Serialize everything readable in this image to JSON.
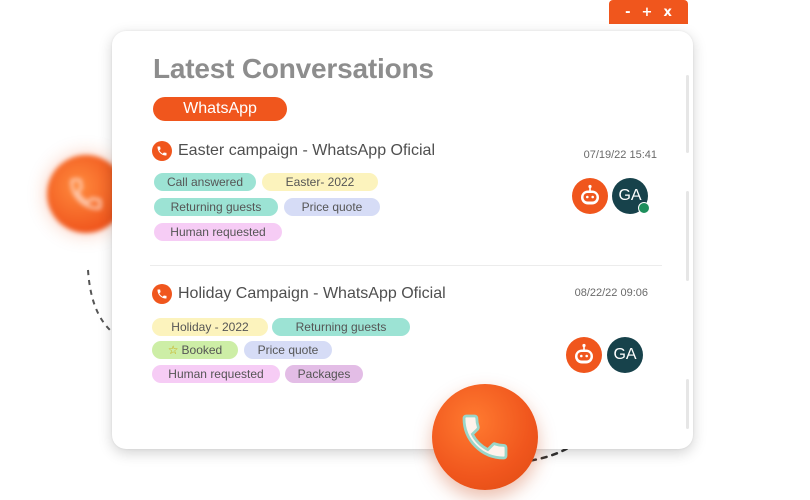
{
  "window": {
    "minimize": "-",
    "maximize": "+",
    "close": "x"
  },
  "panel": {
    "title": "Latest Conversations",
    "channel": "WhatsApp"
  },
  "conversations": [
    {
      "name": "Easter campaign - WhatsApp Oficial",
      "time": "07/19/22 15:41",
      "tags": [
        "Call answered",
        "Easter- 2022",
        "Returning guests",
        "Price quote",
        "Human requested"
      ],
      "agent": {
        "initials": "GA",
        "online": true
      }
    },
    {
      "name": "Holiday Campaign - WhatsApp Oficial",
      "time": "08/22/22 09:06",
      "tags": [
        "Holiday - 2022",
        "Returning guests",
        "Booked",
        "Price quote",
        "Human requested",
        "Packages"
      ],
      "agent": {
        "initials": "GA",
        "online": false
      }
    }
  ],
  "colors": {
    "accent": "#f0561d",
    "agent_avatar": "#17424b",
    "online": "#1e8f5c",
    "title_text": "#8d8d8d"
  },
  "icons": [
    "phone-icon",
    "bot-icon",
    "star-icon"
  ]
}
